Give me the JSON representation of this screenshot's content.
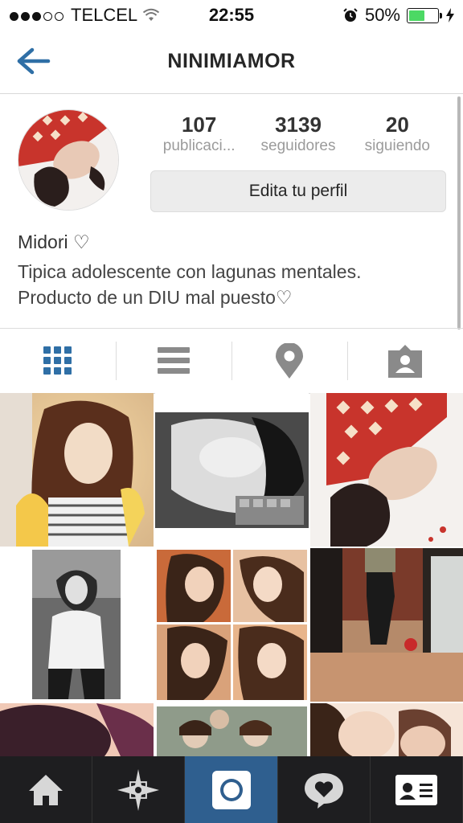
{
  "status_bar": {
    "carrier": "TELCEL",
    "time": "22:55",
    "battery": "50%"
  },
  "nav": {
    "title": "NINIMIAMOR"
  },
  "profile": {
    "stats": [
      {
        "value": "107",
        "label": "publicaci..."
      },
      {
        "value": "3139",
        "label": "seguidores"
      },
      {
        "value": "20",
        "label": "siguiendo"
      }
    ],
    "edit_button": "Edita tu perfil",
    "name": "Midori ♡",
    "bio_lines": [
      "Tipica adolescente con lagunas mentales.",
      "Producto de un DIU mal puesto♡"
    ]
  },
  "view_tabs": [
    {
      "icon": "grid-icon",
      "active": true
    },
    {
      "icon": "list-icon",
      "active": false
    },
    {
      "icon": "location-pin-icon",
      "active": false
    },
    {
      "icon": "tagged-person-icon",
      "active": false
    }
  ],
  "bottom_tabs": [
    {
      "icon": "home-icon"
    },
    {
      "icon": "explore-star-icon"
    },
    {
      "icon": "camera-icon",
      "active": true
    },
    {
      "icon": "activity-heart-icon"
    },
    {
      "icon": "profile-card-icon"
    }
  ],
  "colors": {
    "accent": "#2f5f8f",
    "icon_gray": "#8a8a8a",
    "tabbar_bg": "#1e1e20",
    "battery_green": "#4cd964"
  }
}
